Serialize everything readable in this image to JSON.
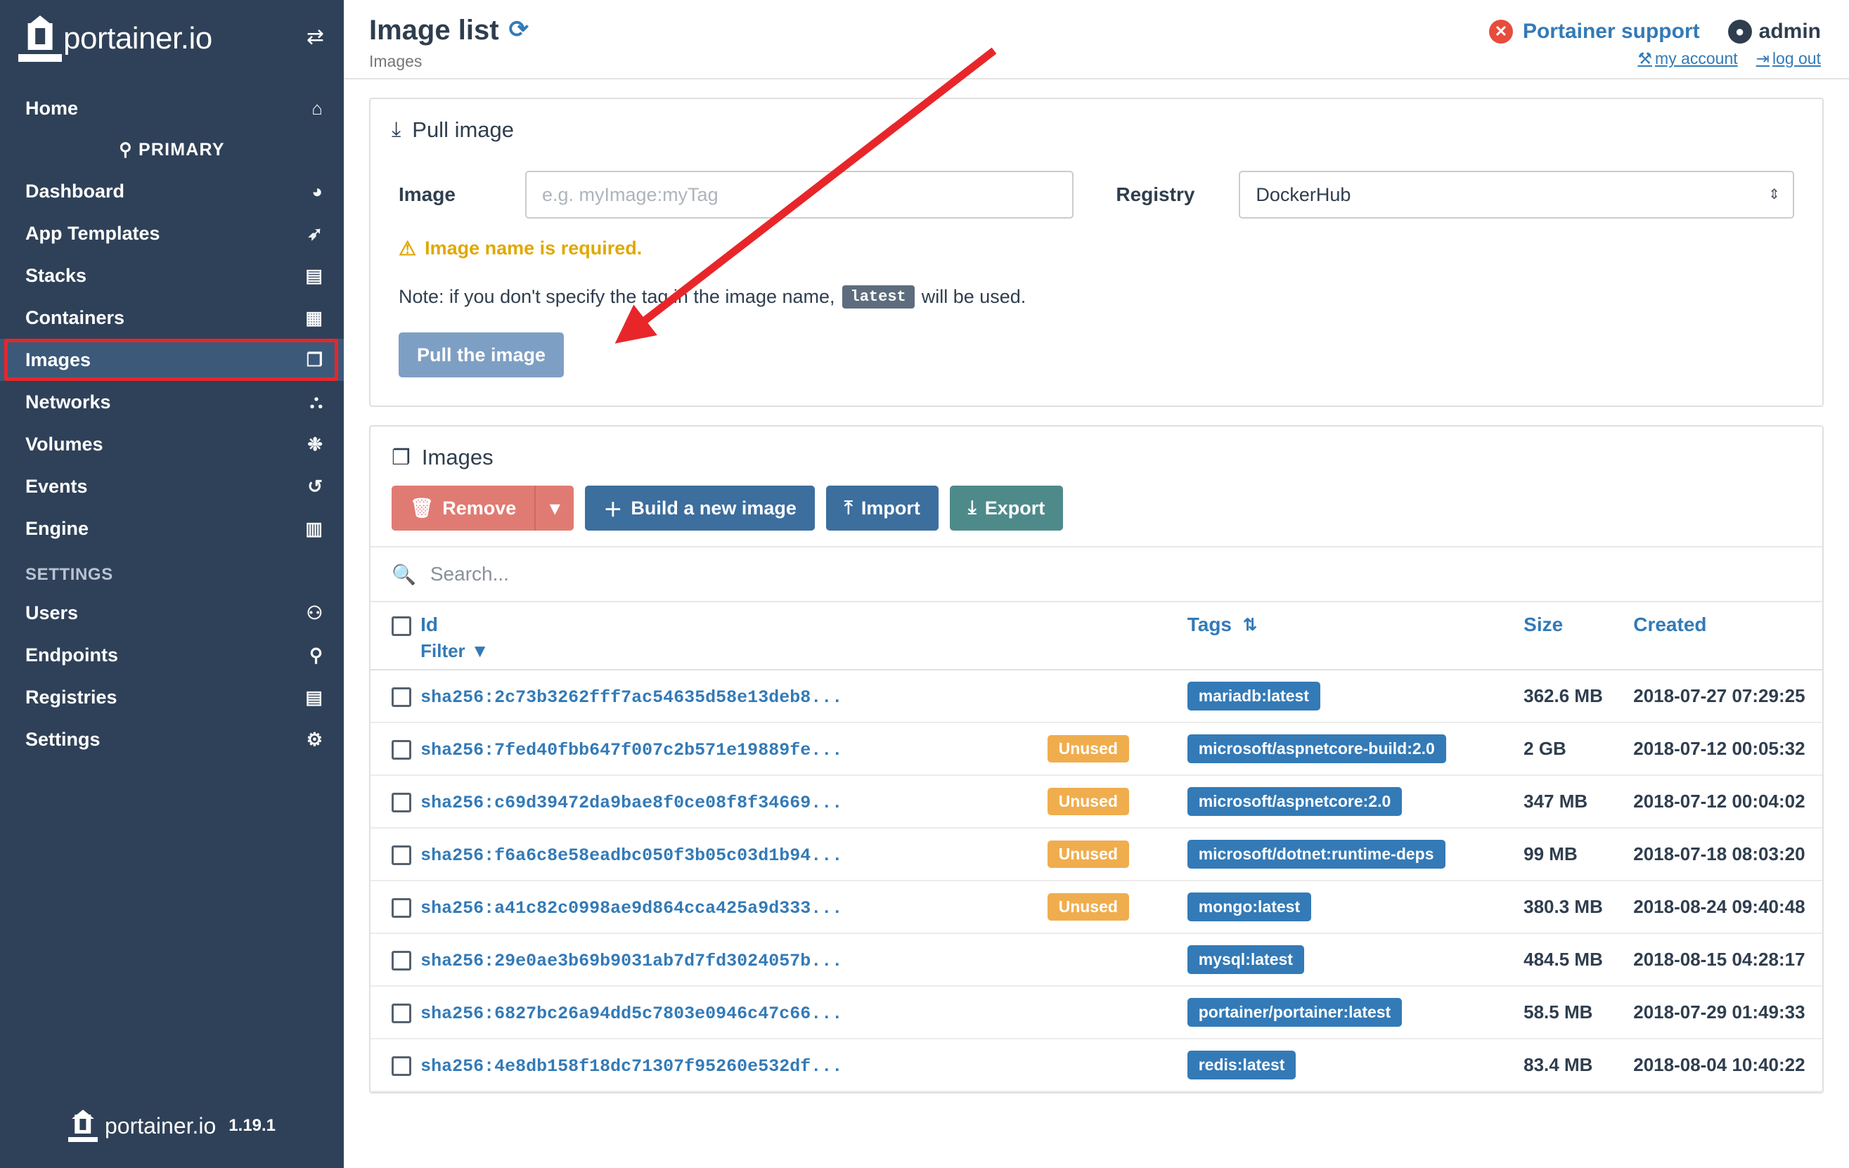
{
  "sidebar": {
    "brand": "portainer.io",
    "brand_logo_icon": "portainer-lighthouse-icon",
    "toggle_icon": "collapse-sidebar-icon",
    "endpoint_label": "PRIMARY",
    "endpoint_icon": "plug-icon",
    "items": [
      {
        "label": "Home",
        "icon": "home-icon",
        "name": "sidebar-item-home",
        "active": false
      },
      {
        "label": "Dashboard",
        "icon": "dashboard-icon",
        "name": "sidebar-item-dashboard",
        "active": false
      },
      {
        "label": "App Templates",
        "icon": "rocket-icon",
        "name": "sidebar-item-app-templates",
        "active": false
      },
      {
        "label": "Stacks",
        "icon": "stacks-icon",
        "name": "sidebar-item-stacks",
        "active": false
      },
      {
        "label": "Containers",
        "icon": "containers-icon",
        "name": "sidebar-item-containers",
        "active": false
      },
      {
        "label": "Images",
        "icon": "images-icon",
        "name": "sidebar-item-images",
        "active": true
      },
      {
        "label": "Networks",
        "icon": "networks-icon",
        "name": "sidebar-item-networks",
        "active": false
      },
      {
        "label": "Volumes",
        "icon": "volumes-icon",
        "name": "sidebar-item-volumes",
        "active": false
      },
      {
        "label": "Events",
        "icon": "history-icon",
        "name": "sidebar-item-events",
        "active": false
      },
      {
        "label": "Engine",
        "icon": "engine-icon",
        "name": "sidebar-item-engine",
        "active": false
      }
    ],
    "settings_section": "SETTINGS",
    "settings_items": [
      {
        "label": "Users",
        "icon": "users-icon",
        "name": "sidebar-item-users"
      },
      {
        "label": "Endpoints",
        "icon": "plug-icon",
        "name": "sidebar-item-endpoints"
      },
      {
        "label": "Registries",
        "icon": "database-icon",
        "name": "sidebar-item-registries"
      },
      {
        "label": "Settings",
        "icon": "gear-icon",
        "name": "sidebar-item-settings"
      }
    ],
    "footer_brand": "portainer.io",
    "footer_version": "1.19.1"
  },
  "header": {
    "title": "Image list",
    "refresh_icon": "refresh-icon",
    "breadcrumb": "Images",
    "support_label": "Portainer support",
    "support_icon": "support-close-icon",
    "user_label": "admin",
    "user_icon": "user-circle-icon",
    "my_account_label": "my account",
    "my_account_icon": "wrench-icon",
    "logout_label": "log out",
    "logout_icon": "logout-icon"
  },
  "pull_panel": {
    "title": "Pull image",
    "icon": "download-image-icon",
    "image_label": "Image",
    "image_placeholder": "e.g. myImage:myTag",
    "image_value": "",
    "registry_label": "Registry",
    "registry_value": "DockerHub",
    "registry_options": [
      "DockerHub"
    ],
    "warning_icon": "warning-icon",
    "warning_text": "Image name is required.",
    "note_prefix": "Note: if you don't specify the tag in the image name,",
    "note_tag": "latest",
    "note_suffix": "will be used.",
    "pull_button": "Pull the image"
  },
  "images_panel": {
    "title": "Images",
    "icon": "images-icon",
    "toolbar": {
      "remove_label": "Remove",
      "remove_icon": "trash-icon",
      "remove_caret_icon": "chevron-down-icon",
      "build_label": "Build a new image",
      "build_icon": "plus-icon",
      "import_label": "Import",
      "import_icon": "upload-icon",
      "export_label": "Export",
      "export_icon": "download-icon"
    },
    "search_placeholder": "Search...",
    "search_value": "",
    "search_icon": "search-icon",
    "columns": {
      "id": "Id",
      "filter": "Filter",
      "filter_icon": "filter-icon",
      "tags": "Tags",
      "tags_sort_icon": "sort-icon",
      "size": "Size",
      "created": "Created"
    },
    "rows": [
      {
        "id": "sha256:2c73b3262fff7ac54635d58e13deb8...",
        "unused": "",
        "tag": "mariadb:latest",
        "size": "362.6 MB",
        "created": "2018-07-27 07:29:25"
      },
      {
        "id": "sha256:7fed40fbb647f007c2b571e19889fe...",
        "unused": "Unused",
        "tag": "microsoft/aspnetcore-build:2.0",
        "size": "2 GB",
        "created": "2018-07-12 00:05:32"
      },
      {
        "id": "sha256:c69d39472da9bae8f0ce08f8f34669...",
        "unused": "Unused",
        "tag": "microsoft/aspnetcore:2.0",
        "size": "347 MB",
        "created": "2018-07-12 00:04:02"
      },
      {
        "id": "sha256:f6a6c8e58eadbc050f3b05c03d1b94...",
        "unused": "Unused",
        "tag": "microsoft/dotnet:runtime-deps",
        "size": "99 MB",
        "created": "2018-07-18 08:03:20"
      },
      {
        "id": "sha256:a41c82c0998ae9d864cca425a9d333...",
        "unused": "Unused",
        "tag": "mongo:latest",
        "size": "380.3 MB",
        "created": "2018-08-24 09:40:48"
      },
      {
        "id": "sha256:29e0ae3b69b9031ab7d7fd3024057b...",
        "unused": "",
        "tag": "mysql:latest",
        "size": "484.5 MB",
        "created": "2018-08-15 04:28:17"
      },
      {
        "id": "sha256:6827bc26a94dd5c7803e0946c47c66...",
        "unused": "",
        "tag": "portainer/portainer:latest",
        "size": "58.5 MB",
        "created": "2018-07-29 01:49:33"
      },
      {
        "id": "sha256:4e8db158f18dc71307f95260e532df...",
        "unused": "",
        "tag": "redis:latest",
        "size": "83.4 MB",
        "created": "2018-08-04 10:40:22"
      }
    ]
  },
  "annotation": {
    "arrow_color": "#e8262a",
    "description": "arrow pointing to Images sidebar item"
  }
}
